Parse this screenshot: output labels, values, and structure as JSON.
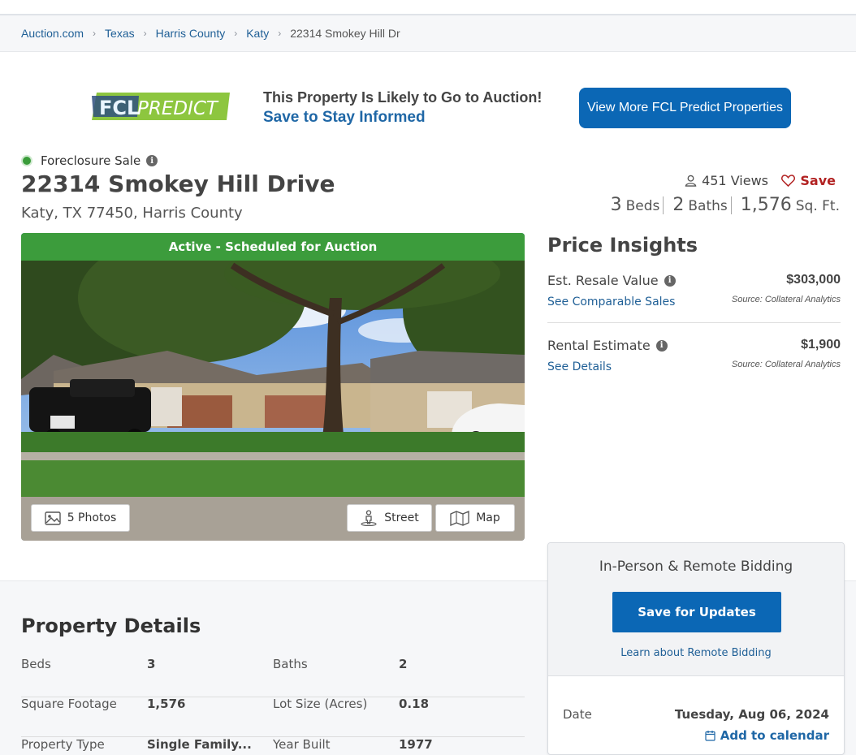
{
  "breadcrumb": {
    "items": [
      "Auction.com",
      "Texas",
      "Harris County",
      "Katy"
    ],
    "current": "22314 Smokey Hill Dr"
  },
  "promo": {
    "logo_text_a": "FCL",
    "logo_text_b": "PREDICT",
    "title": "This Property Is Likely to Go to Auction!",
    "subtitle": "Save to Stay Informed",
    "button_label": "View More FCL Predict Properties"
  },
  "listing": {
    "sale_type": "Foreclosure Sale",
    "address": "22314 Smokey Hill Drive",
    "city_line": "Katy, TX 77450, Harris County",
    "views": "451 Views",
    "save_label": "Save",
    "beds": "3",
    "beds_label": "Beds",
    "baths": "2",
    "baths_label": "Baths",
    "sqft": "1,576",
    "sqft_label": "Sq. Ft."
  },
  "photo": {
    "status_banner": "Active - Scheduled for Auction",
    "photos_label": "5 Photos",
    "street_label": "Street",
    "map_label": "Map"
  },
  "price_insights": {
    "title": "Price Insights",
    "rows": [
      {
        "label": "Est. Resale Value",
        "link": "See Comparable Sales",
        "value": "$303,000",
        "source": "Source: Collateral Analytics"
      },
      {
        "label": "Rental Estimate",
        "link": "See Details",
        "value": "$1,900",
        "source": "Source: Collateral Analytics"
      }
    ]
  },
  "property_details": {
    "title": "Property Details",
    "rows": [
      {
        "k1": "Beds",
        "v1": "3",
        "k2": "Baths",
        "v2": "2"
      },
      {
        "k1": "Square Footage",
        "v1": "1,576",
        "k2": "Lot Size (Acres)",
        "v2": "0.18"
      },
      {
        "k1": "Property Type",
        "v1": "Single Family...",
        "k2": "Year Built",
        "v2": "1977"
      }
    ]
  },
  "bidding": {
    "title": "In-Person & Remote Bidding",
    "button_label": "Save for Updates",
    "link": "Learn about Remote Bidding",
    "date_label": "Date",
    "date_value": "Tuesday, Aug 06, 2024",
    "calendar_label": "Add to calendar"
  },
  "colors": {
    "primary_blue": "#0b67b5",
    "link_blue": "#1f5f96",
    "status_green": "#3c9c3c",
    "save_red": "#b22222"
  }
}
